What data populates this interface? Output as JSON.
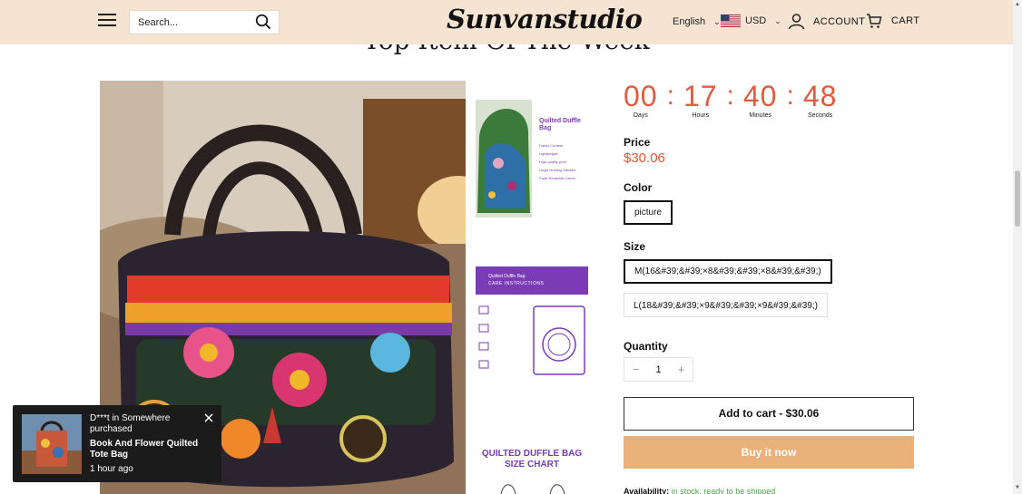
{
  "header": {
    "search_placeholder": "Search...",
    "logo_text": "Sunvanstudio",
    "language": "English",
    "currency": "USD",
    "account_label": "ACCOUNT",
    "cart_label": "CART",
    "background": "#f5e4d2"
  },
  "section": {
    "title": "Top Item Of The Week"
  },
  "gallery": {
    "thumb1": {
      "title": "Quilted Duffle Bag",
      "features": [
        "Fabric Content",
        "Lightweight",
        "High quality print",
        "Large Holding Stitches",
        "Fade-Resistant Colors"
      ]
    },
    "thumb2": {
      "header": "Quilted Duffle Bag",
      "subheader": "CARE INSTRUCTIONS"
    },
    "thumb3": {
      "title": "QUILTED DUFFLE BAG",
      "subtitle": "SIZE CHART"
    }
  },
  "countdown": {
    "days": "00",
    "hours": "17",
    "minutes": "40",
    "seconds": "48",
    "days_label": "Days",
    "hours_label": "Hours",
    "minutes_label": "Minutes",
    "seconds_label": "Seconds",
    "color": "#e35a3e"
  },
  "product": {
    "price_label": "Price",
    "price": "$30.06",
    "color_label": "Color",
    "color_options": [
      "picture"
    ],
    "size_label": "Size",
    "size_options": [
      "M(16&#39;&#39;×8&#39;&#39;×8&#39;&#39;)",
      "L(18&#39;&#39;×9&#39;&#39;×9&#39;&#39;)"
    ],
    "quantity_label": "Quantity",
    "quantity": "1",
    "add_to_cart": "Add to cart - $30.06",
    "buy_now": "Buy it now",
    "availability_label": "Availability:",
    "availability_status": "in stock, ready to be shipped",
    "accent_color": "#e9b27c"
  },
  "popup": {
    "who": "D***t in Somewhere purchased",
    "product": "Book And Flower Quilted Tote Bag",
    "time": "1 hour ago"
  }
}
